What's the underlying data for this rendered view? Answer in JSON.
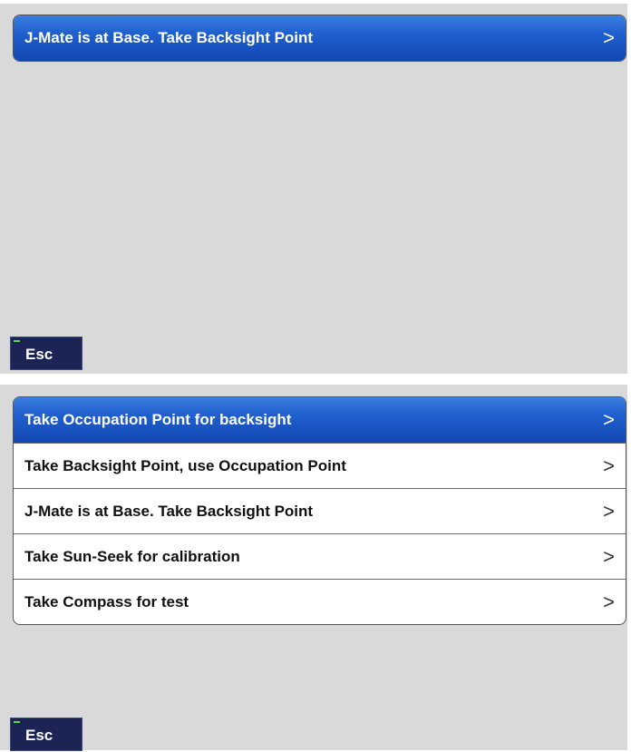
{
  "top_screen": {
    "items": [
      {
        "label": "J-Mate is at Base. Take Backsight Point",
        "chevron": ">"
      }
    ],
    "esc_label": "Esc"
  },
  "bottom_screen": {
    "items": [
      {
        "label": "Take Occupation Point for backsight",
        "chevron": ">"
      },
      {
        "label": "Take Backsight Point, use Occupation Point",
        "chevron": ">"
      },
      {
        "label": "J-Mate is at Base. Take Backsight Point",
        "chevron": ">"
      },
      {
        "label": "Take Sun-Seek for calibration",
        "chevron": ">"
      },
      {
        "label": "Take Compass for test",
        "chevron": ">"
      }
    ],
    "selected_index": 0,
    "esc_label": "Esc"
  },
  "colors": {
    "panel_background": "#d9d9d9",
    "selected_item": "#1f5fce",
    "esc_button": "#1c2355",
    "led": "#55dd44"
  }
}
